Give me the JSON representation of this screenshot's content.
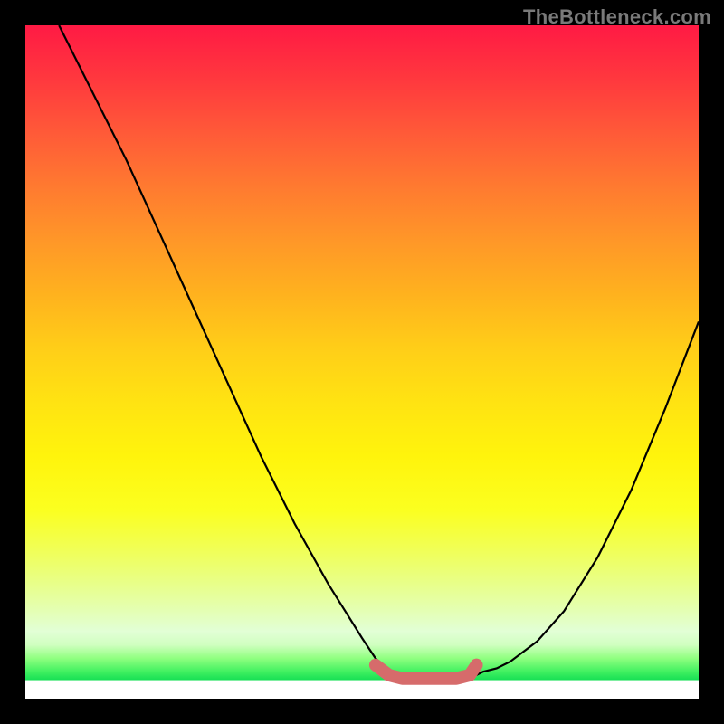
{
  "watermark": "TheBottleneck.com",
  "colors": {
    "curve": "#000000",
    "highlight": "#d66b6b"
  },
  "chart_data": {
    "type": "line",
    "title": "",
    "xlabel": "",
    "ylabel": "",
    "xlim": [
      0,
      100
    ],
    "ylim": [
      0,
      100
    ],
    "grid": false,
    "note": "Background is a vertical red→yellow→green gradient (green at bottom / optimal). Two black curves descend into a flat bottom region; the flat bottom is highlighted in pink indicating the optimal match zone.",
    "series": [
      {
        "name": "left-curve",
        "x": [
          5,
          10,
          15,
          20,
          25,
          30,
          35,
          40,
          45,
          50,
          52,
          54,
          56,
          58,
          60
        ],
        "y": [
          100,
          90,
          80,
          69,
          58,
          47,
          36,
          26,
          17,
          9,
          6,
          4,
          3,
          3,
          3
        ]
      },
      {
        "name": "right-curve",
        "x": [
          60,
          62,
          64,
          66,
          68,
          70,
          72,
          76,
          80,
          85,
          90,
          95,
          100
        ],
        "y": [
          3,
          3,
          3,
          3,
          4,
          4.5,
          5.5,
          8.5,
          13,
          21,
          31,
          43,
          56
        ]
      },
      {
        "name": "highlight",
        "x": [
          52,
          54,
          56,
          58,
          60,
          62,
          64,
          66,
          67
        ],
        "y": [
          5,
          3.5,
          3,
          3,
          3,
          3,
          3,
          3.5,
          5
        ]
      }
    ],
    "right_endpoint": {
      "x": 67,
      "y": 5
    }
  }
}
